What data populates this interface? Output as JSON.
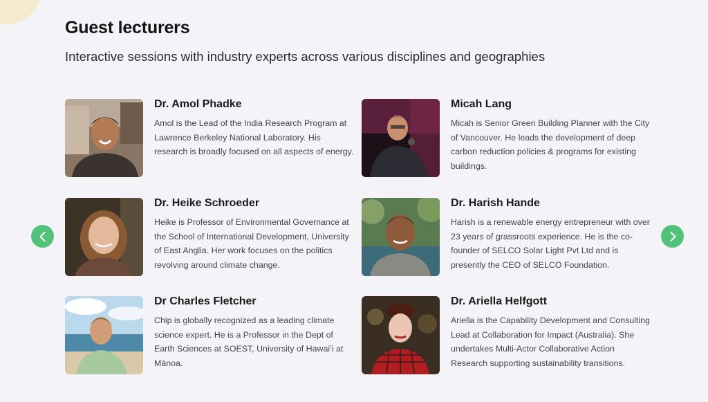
{
  "section": {
    "title": "Guest lecturers",
    "subtitle": "Interactive sessions with industry experts across various disciplines and geographies"
  },
  "colors": {
    "accent": "#52c27a",
    "background": "#f4f4f8"
  },
  "carousel": {
    "prev_icon": "chevron-left-icon",
    "next_icon": "chevron-right-icon"
  },
  "lecturers": [
    {
      "name": "Dr. Amol Phadke",
      "bio": "Amol is the Lead of the India Research Program at Lawrence Berkeley National Laboratory. His research is broadly focused on all aspects of energy."
    },
    {
      "name": "Micah Lang",
      "bio": "Micah is Senior Green Building Planner with the City of Vancouver. He leads the development of deep carbon reduction policies & programs for existing buildings."
    },
    {
      "name": "Dr. Heike Schroeder",
      "bio": "Heike is Professor of Environmental Governance at the School of International Development, University of East Anglia. Her work focuses on the politics revolving around climate change."
    },
    {
      "name": "Dr. Harish Hande",
      "bio": "Harish is a renewable energy entrepreneur with over 23 years of grassroots experience. He is the co-founder of SELCO Solar Light Pvt Ltd and is presently the CEO of SELCO Foundation."
    },
    {
      "name": "Dr Charles Fletcher",
      "bio": "Chip is globally recognized as a leading climate science expert. He is a Professor in the Dept of Earth Sciences at SOEST, University of Hawaiʻi at Mānoa."
    },
    {
      "name": "Dr. Ariella Helfgott",
      "bio": "Ariella is the Capability Development and Consulting Lead at Collaboration for Impact (Australia). She undertakes Multi-Actor Collaborative Action Research supporting sustainability transitions."
    }
  ]
}
